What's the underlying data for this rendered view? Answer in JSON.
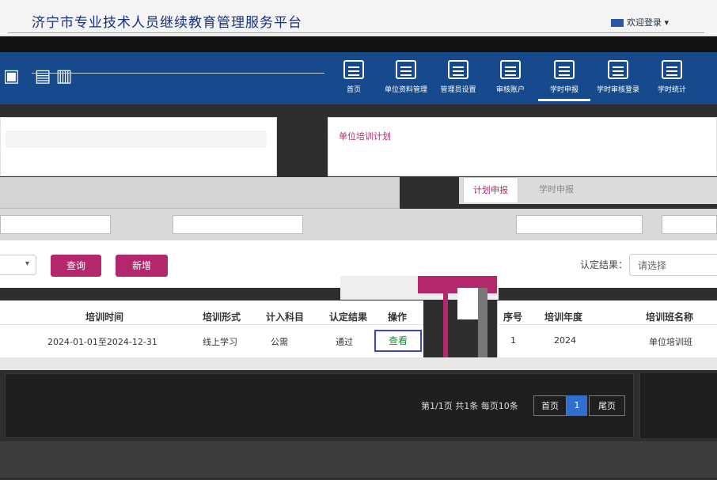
{
  "header": {
    "site_title": "济宁市专业技术人员继续教育管理服务平台",
    "user_text": "欢迎登录"
  },
  "nav": {
    "items": [
      {
        "label": "首页"
      },
      {
        "label": "单位资料管理"
      },
      {
        "label": "管理员设置"
      },
      {
        "label": "审核账户"
      },
      {
        "label": "学时申报"
      },
      {
        "label": "学时审核登录"
      },
      {
        "label": "学时统计"
      }
    ],
    "active_index": 4
  },
  "right_panel": {
    "title": "单位培训计划",
    "tabs": [
      "计划申报",
      "学时申报"
    ]
  },
  "query": {
    "search_label": "查询",
    "add_label": "新增",
    "result_label": "认定结果：",
    "result_placeholder": "请选择"
  },
  "left_table": {
    "columns": [
      "培训时间",
      "培训形式",
      "计入科目",
      "认定结果",
      "操作"
    ],
    "rows": [
      {
        "time": "2024-01-01至2024-12-31",
        "form": "线上学习",
        "subject": "公需",
        "result": "通过",
        "action": "查看"
      }
    ]
  },
  "right_table": {
    "columns": [
      "序号",
      "培训年度",
      "培训班名称"
    ],
    "rows": [
      {
        "index": "1",
        "year": "2024",
        "name": "单位培训班"
      }
    ]
  },
  "pagination": {
    "info": "第1/1页 共1条 每页10条",
    "first_label": "首页",
    "current_page": "1",
    "last_label": "尾页"
  },
  "colors": {
    "accent": "#b5276c",
    "nav_blue": "#174a8c",
    "page_blue": "#2f6fd0"
  }
}
